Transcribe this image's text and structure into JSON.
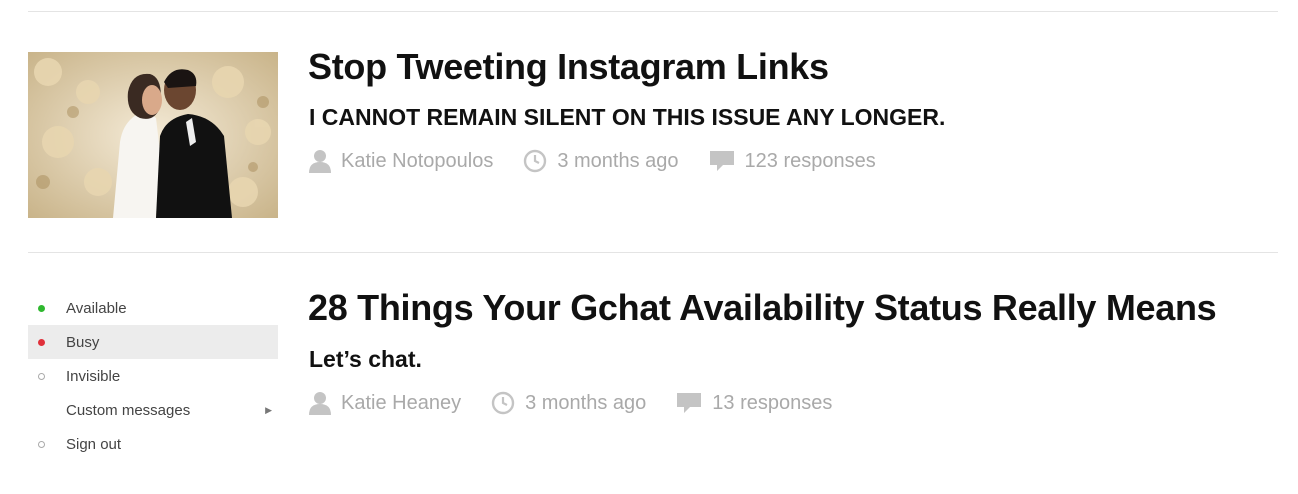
{
  "articles": [
    {
      "title": "Stop Tweeting Instagram Links",
      "dek": "I CANNOT REMAIN SILENT ON THIS ISSUE ANY LONGER.",
      "author": "Katie Notopoulos",
      "time": "3 months ago",
      "responses": "123 responses"
    },
    {
      "title": "28 Things Your Gchat Availability Status Really Means",
      "dek": "Let’s chat.",
      "author": "Katie Heaney",
      "time": "3 months ago",
      "responses": "13 responses"
    }
  ],
  "gchat_menu": {
    "items": [
      {
        "label": "Available",
        "dot_color": "#2fb82f"
      },
      {
        "label": "Busy",
        "dot_color": "#e0303a"
      },
      {
        "label": "Invisible",
        "dot_color": "#b5b5b5"
      },
      {
        "label": "Custom messages",
        "dot_color": ""
      },
      {
        "label": "Sign out",
        "dot_color": "#b5b5b5"
      }
    ]
  },
  "icons": {
    "author": "person-icon",
    "time": "clock-icon",
    "responses": "speech-bubble-icon"
  },
  "colors": {
    "meta_text": "#a9a9a9",
    "divider": "#e4e4e4",
    "menu_highlight": "#ececec"
  }
}
